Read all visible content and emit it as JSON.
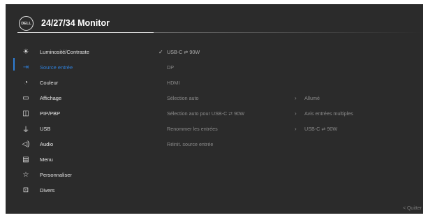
{
  "header": {
    "logo_text": "DELL",
    "title": "24/27/34 Monitor"
  },
  "sidebar": {
    "items": [
      {
        "icon": "brightness-icon",
        "label": "Luminosité/Contraste"
      },
      {
        "icon": "input-source-icon",
        "label": "Source entrée"
      },
      {
        "icon": "color-palette-icon",
        "label": "Couleur"
      },
      {
        "icon": "display-icon",
        "label": "Affichage"
      },
      {
        "icon": "pip-pbp-icon",
        "label": "PIP/PBP"
      },
      {
        "icon": "usb-icon",
        "label": "USB"
      },
      {
        "icon": "speaker-icon",
        "label": "Audio"
      },
      {
        "icon": "menu-icon",
        "label": "Menu"
      },
      {
        "icon": "star-icon",
        "label": "Personnaliser"
      },
      {
        "icon": "info-icon",
        "label": "Divers"
      }
    ],
    "active_index": 1
  },
  "main": {
    "options": [
      {
        "label": "USB-C ⇄ 90W",
        "selected": true,
        "value": ""
      },
      {
        "label": "DP",
        "selected": false,
        "value": ""
      },
      {
        "label": "HDMI",
        "selected": false,
        "value": ""
      },
      {
        "label": "Sélection auto",
        "selected": false,
        "value": "Allumé"
      },
      {
        "label": "Sélection auto pour USB-C ⇄ 90W",
        "selected": false,
        "value": "Avis entrées multiples"
      },
      {
        "label": "Renommer les entrées",
        "selected": false,
        "value": "USB-C ⇄ 90W"
      },
      {
        "label": "Réinit. source entrée",
        "selected": false,
        "value": ""
      }
    ]
  },
  "footer": {
    "quit_label": "< Quitter"
  },
  "colors": {
    "background": "#2b2b2b",
    "accent": "#2f7fd8",
    "text": "#e6e6e6",
    "dim_text": "#8a8a8a"
  }
}
